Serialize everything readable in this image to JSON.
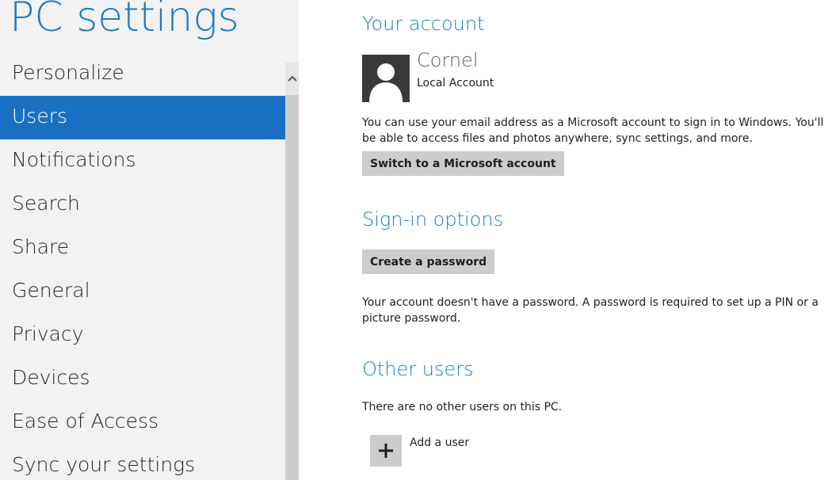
{
  "app": {
    "title": "PC settings"
  },
  "nav": {
    "items": [
      {
        "label": "Personalize"
      },
      {
        "label": "Users"
      },
      {
        "label": "Notifications"
      },
      {
        "label": "Search"
      },
      {
        "label": "Share"
      },
      {
        "label": "General"
      },
      {
        "label": "Privacy"
      },
      {
        "label": "Devices"
      },
      {
        "label": "Ease of Access"
      },
      {
        "label": "Sync your settings"
      }
    ],
    "selected": "Users"
  },
  "account": {
    "heading": "Your account",
    "user_name": "Cornel",
    "account_type": "Local Account",
    "description": "You can use your email address as a Microsoft account to sign in to Windows. You'll be able to access files and photos anywhere, sync settings, and more.",
    "switch_button": "Switch to a Microsoft account"
  },
  "signin": {
    "heading": "Sign-in options",
    "create_password_button": "Create a password",
    "note": "Your account doesn't have a password. A password is required to set up a PIN or a picture password."
  },
  "other_users": {
    "heading": "Other users",
    "note": "There are no other users on this PC.",
    "add_user_label": "Add a user"
  },
  "colors": {
    "accent": "#1d7cc3",
    "selected_bg": "#1a70c2",
    "left_pane_bg": "#f2f2f2",
    "button_bg": "#cccccc"
  },
  "icons": {
    "avatar": "user-silhouette-icon",
    "add_user": "plus-icon",
    "scroll_up": "chevron-up-icon"
  }
}
